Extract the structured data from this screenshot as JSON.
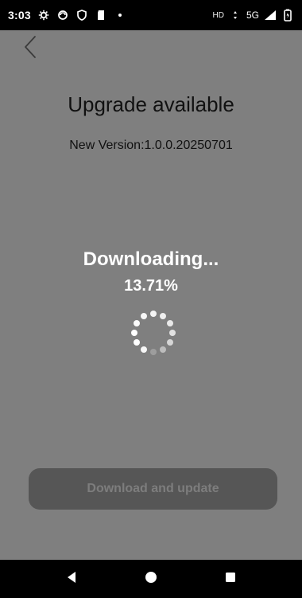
{
  "status_bar": {
    "time": "3:03",
    "network_label": "5G",
    "hd_label": "HD"
  },
  "header": {
    "title": "Upgrade available",
    "version_text": "New Version:1.0.0.20250701"
  },
  "download": {
    "status_text": "Downloading...",
    "progress_text": "13.71%",
    "progress_value": 13.71
  },
  "actions": {
    "primary_label": "Download and update"
  },
  "icons": {
    "back": "back-icon",
    "settings": "gear-icon",
    "sync": "sync-icon",
    "shield": "shield-icon",
    "sd_card": "sd-card-icon",
    "notification_dot": "dot-icon",
    "wifi": "wifi-icon",
    "signal": "signal-icon",
    "battery": "battery-icon",
    "nav_back": "back-triangle-icon",
    "nav_home": "home-circle-icon",
    "nav_recents": "recents-square-icon"
  },
  "colors": {
    "overlay_background": "#7f7f7f",
    "button_background": "#565656",
    "button_text": "#7d7d7d",
    "status_bar": "#000000"
  }
}
